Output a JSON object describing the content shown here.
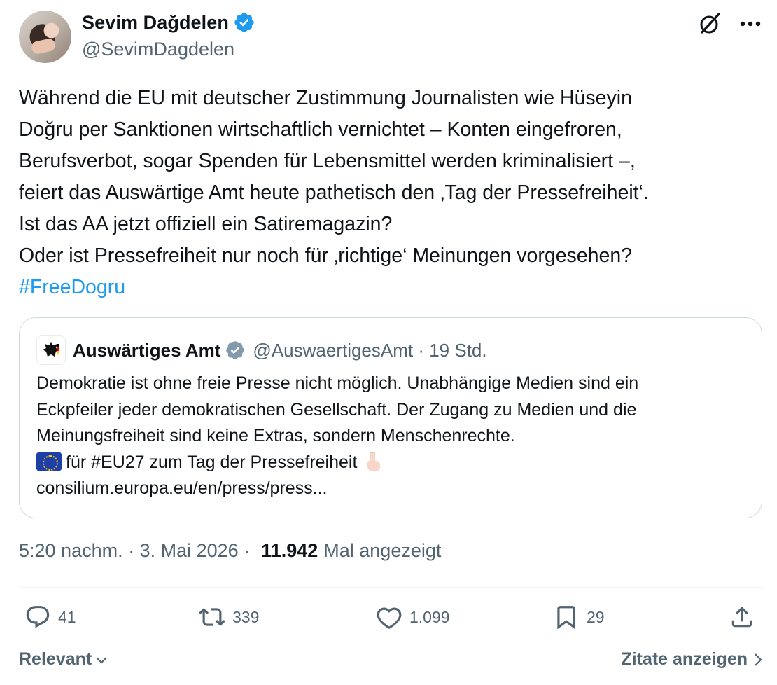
{
  "author": {
    "display_name": "Sevim Dağdelen",
    "handle": "@SevimDagdelen",
    "verified_color": "#1d9bf0"
  },
  "top_icons": [
    "grok-icon",
    "more-icon"
  ],
  "tweet": {
    "text": "Während die EU mit deutscher Zustimmung Journalisten wie Hüseyin\nDoğru per Sanktionen wirtschaftlich vernichtet – Konten eingefroren,\nBerufsverbot, sogar Spenden für Lebensmittel werden kriminalisiert –,\nfeiert das Auswärtige Amt heute pathetisch den ‚Tag der Pressefreiheit‘.\nIst das AA jetzt offiziell ein Satiremagazin?\nOder ist Pressefreiheit nur noch für ‚richtige‘ Meinungen vorgesehen?\n",
    "hashtag": "#FreeDogru",
    "hashtag_color": "#1d9bf0"
  },
  "quote": {
    "name": "Auswärtiges Amt",
    "handle_time": "@AuswaertigesAmt · 19 Std.",
    "verified_color": "#829aab",
    "line1": "Demokratie ist ohne freie Presse nicht möglich. Unabhängige Medien sind ein",
    "line2": "Eckpfeiler jeder demokratischen Gesellschaft. Der Zugang zu Medien und die",
    "line3": "Meinungsfreiheit sind keine Extras, sondern Menschenrechte.",
    "line4": "für #EU27 zum Tag der Pressefreiheit",
    "line5": "consilium.europa.eu/en/press/press..."
  },
  "meta": {
    "time_date": "5:20 nachm. · 3. Mai 2026 ·",
    "views": "11.942",
    "views_label": "Mal angezeigt"
  },
  "actions": {
    "replies": "41",
    "reposts": "339",
    "likes": "1.099",
    "bookmarks": "29"
  },
  "footer": {
    "sort_label": "Relevant",
    "quotes_label": "Zitate anzeigen"
  }
}
